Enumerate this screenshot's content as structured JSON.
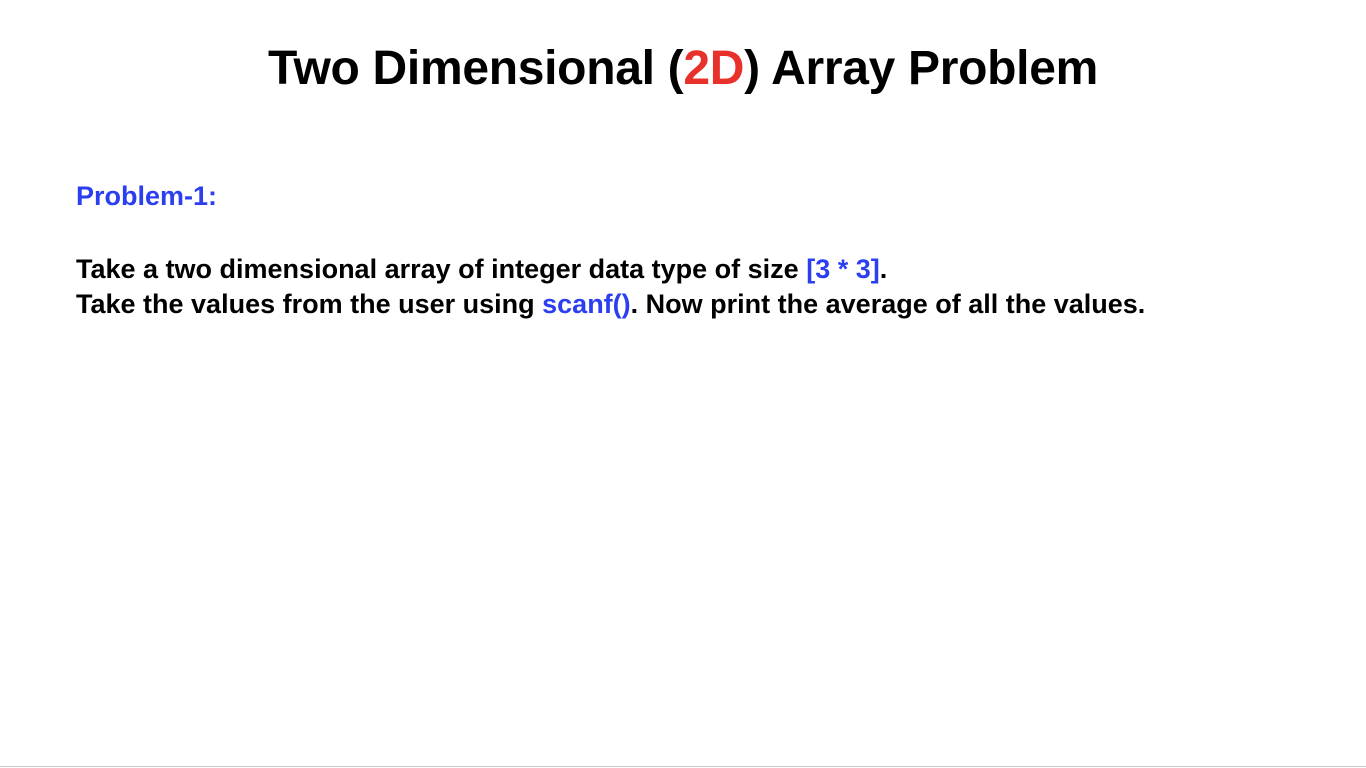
{
  "colors": {
    "text": "#000000",
    "accent_red": "#e8312a",
    "accent_blue": "#2b3ff0"
  },
  "title": {
    "part1": "Two Dimensional (",
    "highlight": "2D",
    "part2": ") Array Problem"
  },
  "problem": {
    "label": "Problem-1:",
    "line1": {
      "text": "Take a two dimensional array of integer data type of size ",
      "highlight": "[3 * 3]",
      "end": "."
    },
    "line2": {
      "text": "Take the values from the user using ",
      "highlight": "scanf()",
      "end": ". Now print the average of all the values."
    }
  }
}
